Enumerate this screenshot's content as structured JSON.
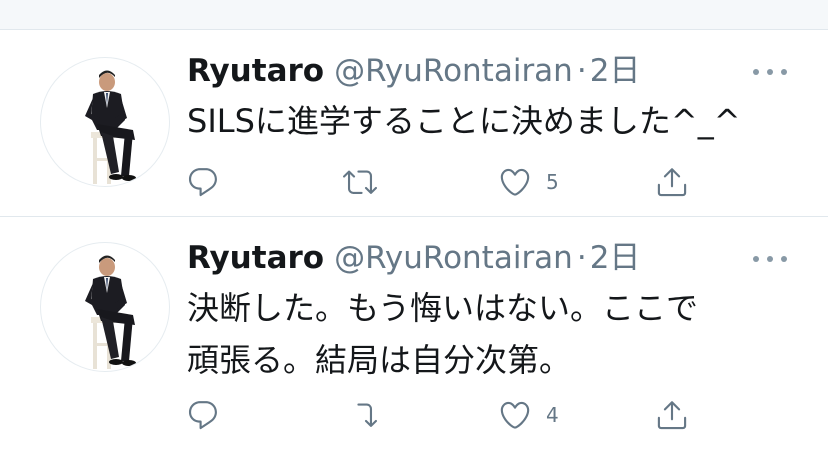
{
  "tweets": [
    {
      "name": "Ryutaro",
      "handle": "@RyuRontairan",
      "separator": "·",
      "time": "2日",
      "text_lines": [
        "SILSに進学することに決めました^_^"
      ],
      "likes": "5"
    },
    {
      "name": "Ryutaro",
      "handle": "@RyuRontairan",
      "separator": "·",
      "time": "2日",
      "text_lines": [
        "決断した。もう悔いはない。ここで",
        "頑張る。結局は自分次第。"
      ],
      "likes": "4"
    }
  ],
  "icons": {
    "reply": "reply-icon",
    "retweet": "retweet-icon",
    "like": "heart-icon",
    "share": "share-icon",
    "more": "more-icon"
  },
  "colors": {
    "text": "#14171a",
    "secondary": "#657786",
    "divider": "#e1e8ed",
    "band": "#f5f8fa"
  }
}
